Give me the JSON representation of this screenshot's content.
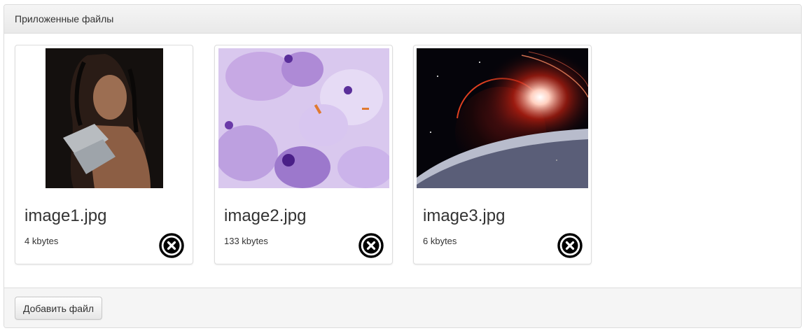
{
  "panel": {
    "title": "Приложенные файлы"
  },
  "files": [
    {
      "name": "image1.jpg",
      "size": "4 kbytes"
    },
    {
      "name": "image2.jpg",
      "size": "133 kbytes"
    },
    {
      "name": "image3.jpg",
      "size": "6 kbytes"
    }
  ],
  "footer": {
    "add_label": "Добавить файл"
  },
  "icons": {
    "remove": "close-circle-icon"
  }
}
